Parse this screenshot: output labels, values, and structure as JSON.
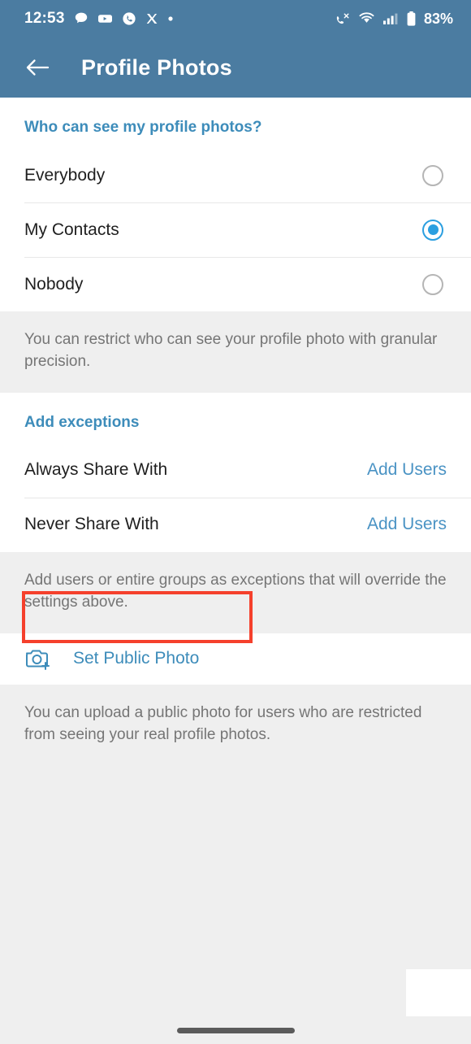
{
  "status_bar": {
    "time": "12:53",
    "left_icons": [
      "chat-bubble-icon",
      "youtube-icon",
      "phone-circle-icon",
      "x-twitter-icon",
      "dot-icon"
    ],
    "right_icons": [
      "phone-signal-icon",
      "wifi-icon",
      "cellular-signal-icon",
      "battery-icon"
    ],
    "battery_percent": "83%"
  },
  "app_bar": {
    "back_icon": "arrow-left-icon",
    "title": "Profile Photos"
  },
  "visibility_section": {
    "heading": "Who can see my profile photos?",
    "options": [
      {
        "label": "Everybody",
        "selected": false
      },
      {
        "label": "My Contacts",
        "selected": true
      },
      {
        "label": "Nobody",
        "selected": false
      }
    ],
    "hint": "You can restrict who can see your profile photo with granular precision."
  },
  "exceptions_section": {
    "heading": "Add exceptions",
    "rows": [
      {
        "label": "Always Share With",
        "action": "Add Users"
      },
      {
        "label": "Never Share With",
        "action": "Add Users"
      }
    ],
    "hint": "Add users or entire groups as exceptions that will override the settings above."
  },
  "public_photo_section": {
    "icon": "camera-plus-icon",
    "label": "Set Public Photo",
    "hint": "You can upload a public photo for users who are restricted from seeing your real profile photos."
  },
  "annotation": {
    "highlight_color": "#f5402c",
    "target": "Set Public Photo"
  },
  "nav_bar": {
    "home_indicator": "home-indicator"
  },
  "colors": {
    "app_bar": "#4b7ca1",
    "accent_blue": "#3d8cba",
    "radio_selected": "#2b9fe0",
    "page_background": "#efefef",
    "card_background": "#ffffff"
  }
}
